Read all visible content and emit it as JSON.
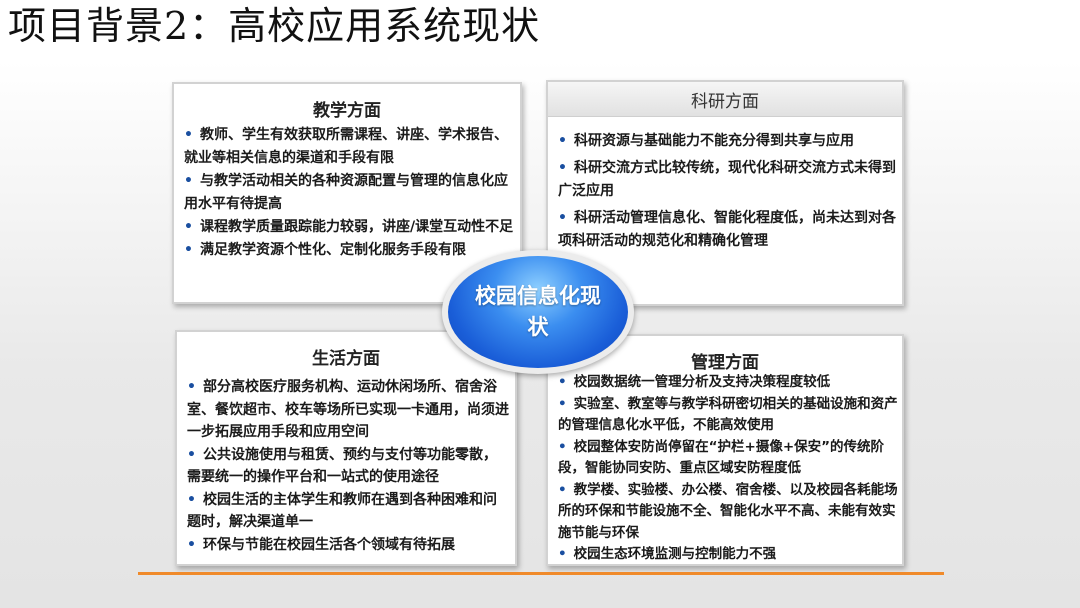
{
  "slide": {
    "title": "项目背景2：高校应用系统现状",
    "center": "校园信息化现状"
  },
  "panels": {
    "teaching": {
      "title": "教学方面",
      "items": [
        "教师、学生有效获取所需课程、讲座、学术报告、就业等相关信息的渠道和手段有限",
        "与教学活动相关的各种资源配置与管理的信息化应用水平有待提高",
        "课程教学质量跟踪能力较弱，讲座/课堂互动性不足",
        "满足教学资源个性化、定制化服务手段有限"
      ]
    },
    "research": {
      "title": "科研方面",
      "items": [
        "科研资源与基础能力不能充分得到共享与应用",
        "科研交流方式比较传统，现代化科研交流方式未得到广泛应用",
        "科研活动管理信息化、智能化程度低，尚未达到对各项科研活动的规范化和精确化管理"
      ]
    },
    "life": {
      "title": "生活方面",
      "items": [
        "部分高校医疗服务机构、运动休闲场所、宿舍浴室、餐饮超市、校车等场所已实现一卡通用，尚须进一步拓展应用手段和应用空间",
        "公共设施使用与租赁、预约与支付等功能零散，需要统一的操作平台和一站式的使用途径",
        "校园生活的主体学生和教师在遇到各种困难和问题时，解决渠道单一",
        "环保与节能在校园生活各个领域有待拓展"
      ]
    },
    "management": {
      "title": "管理方面",
      "items": [
        "校园数据统一管理分析及支持决策程度较低",
        "实验室、教室等与教学科研密切相关的基础设施和资产的管理信息化水平低，不能高效使用",
        "校园整体安防尚停留在“护栏+摄像+保安”的传统阶段，智能协同安防、重点区域安防程度低",
        "教学楼、实验楼、办公楼、宿舍楼、以及校园各耗能场所的环保和节能设施不全、智能化水平不高、未能有效实施节能与环保",
        "校园生态环境监测与控制能力不强"
      ]
    }
  },
  "colors": {
    "accent_line": "#f08a2a",
    "center_blue": "#1a5ed8",
    "bullet": "#1a4fa0"
  }
}
